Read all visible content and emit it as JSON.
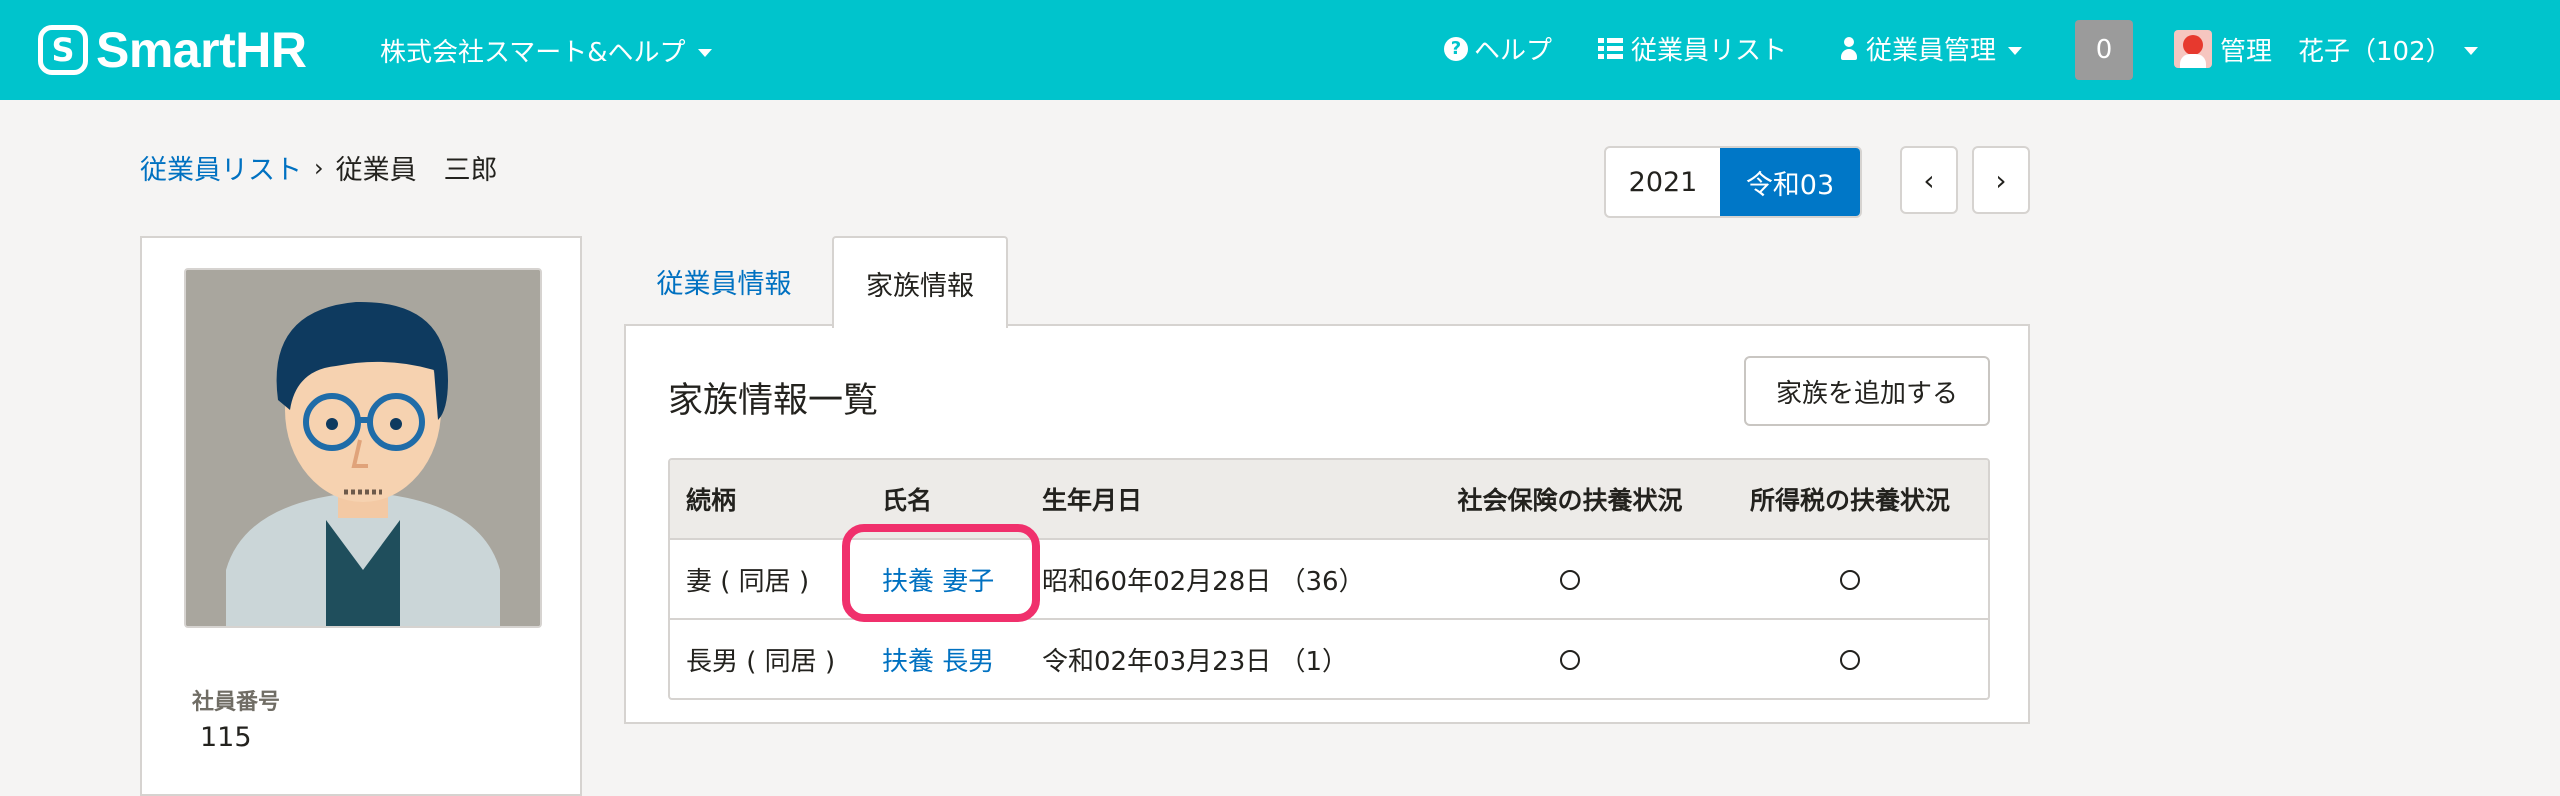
{
  "header": {
    "logo_mark": "S",
    "logo_text": "SmartHR",
    "company": "株式会社スマート&ヘルプ",
    "help": "ヘルプ",
    "employee_list": "従業員リスト",
    "employee_mgmt": "従業員管理",
    "notifications": "0",
    "user": "管理　花子（102）",
    "brand_color": "#00c4cc"
  },
  "breadcrumb": {
    "parent": "従業員リスト",
    "separator": "›",
    "current": "従業員　三郎"
  },
  "year_switch": {
    "western": "2021",
    "japanese": "令和03",
    "prev": "‹",
    "next": "›"
  },
  "profile": {
    "employee_number_label": "社員番号",
    "employee_number": "115"
  },
  "tabs": [
    {
      "label": "従業員情報",
      "active": false
    },
    {
      "label": "家族情報",
      "active": true
    }
  ],
  "family": {
    "title": "家族情報一覧",
    "add_button": "家族を追加する",
    "columns": [
      "続柄",
      "氏名",
      "生年月日",
      "社会保険の扶養状況",
      "所得税の扶養状況"
    ],
    "rows": [
      {
        "relation": "妻 ( 同居 )",
        "name": "扶養 妻子",
        "birth": "昭和60年02月28日 （36）",
        "social_insurance": "○",
        "income_tax": "○"
      },
      {
        "relation": "長男 ( 同居 )",
        "name": "扶養 長男",
        "birth": "令和02年03月23日 （1）",
        "social_insurance": "○",
        "income_tax": "○"
      }
    ]
  },
  "colors": {
    "link": "#0071c1",
    "active_year": "#0077c7",
    "highlight": "#f0306c"
  }
}
